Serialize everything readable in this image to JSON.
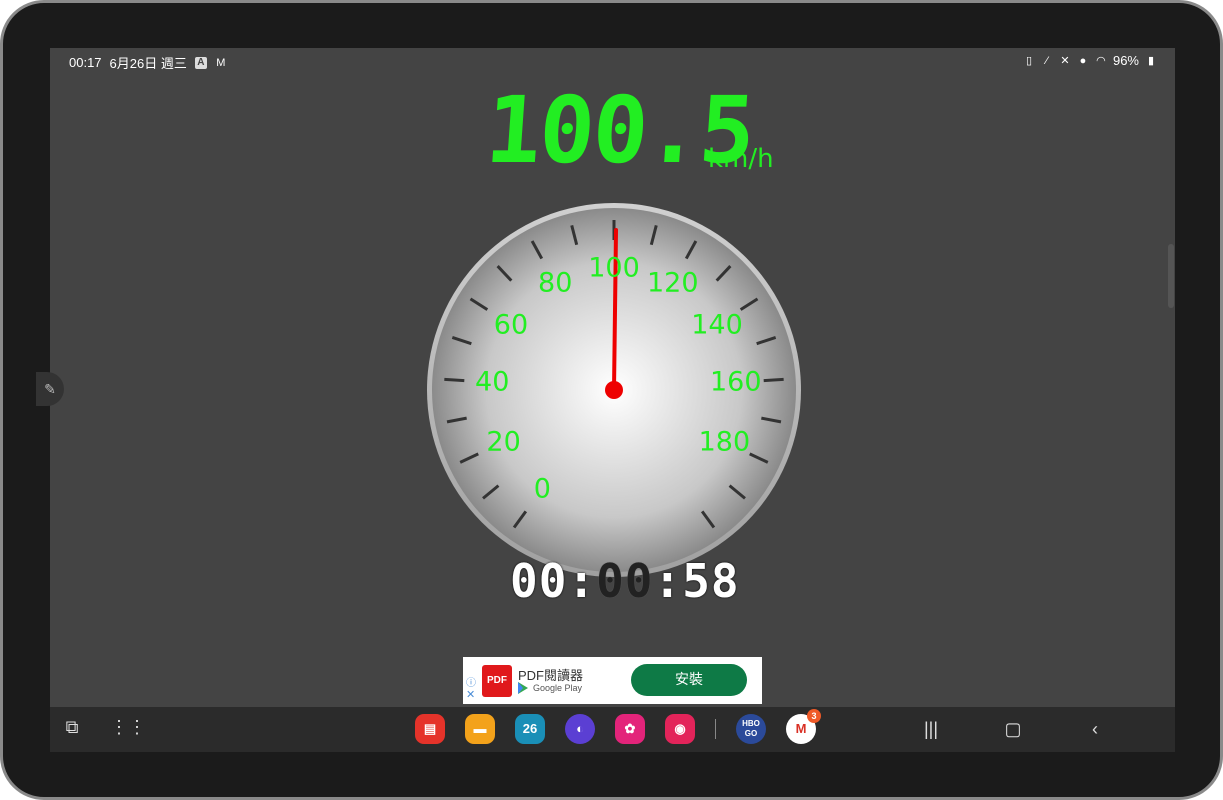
{
  "status_bar": {
    "time": "00:17",
    "date": "6月26日 週三",
    "battery": "96%"
  },
  "speedometer": {
    "speed": "100.5",
    "unit": "km/h",
    "needle_value": 100.5,
    "dial_labels": [
      "0",
      "20",
      "40",
      "60",
      "80",
      "100",
      "120",
      "140",
      "160",
      "180"
    ]
  },
  "timer": {
    "hours": "00",
    "minutes": "00",
    "seconds": "58"
  },
  "ad": {
    "app_name": "PDF閱讀器",
    "store": "Google Play",
    "logo_text": "PDF",
    "install_label": "安裝"
  },
  "taskbar": {
    "calendar_day": "26",
    "hbo_label": "HBO GO",
    "gmail_badge": "3",
    "app_colors": {
      "notes": "#e5332a",
      "files": "#f3a21b",
      "calendar": "#1a8fb7",
      "internet": "#5b3fd3",
      "gallery": "#e3247a",
      "camera": "#e3245a",
      "hbo": "#2b4a9a",
      "gmail": "#ffffff"
    }
  },
  "colors": {
    "screen_bg": "#444444",
    "speed_green": "#22ee22",
    "needle": "#ee0000",
    "install_button": "#0e7a46"
  }
}
